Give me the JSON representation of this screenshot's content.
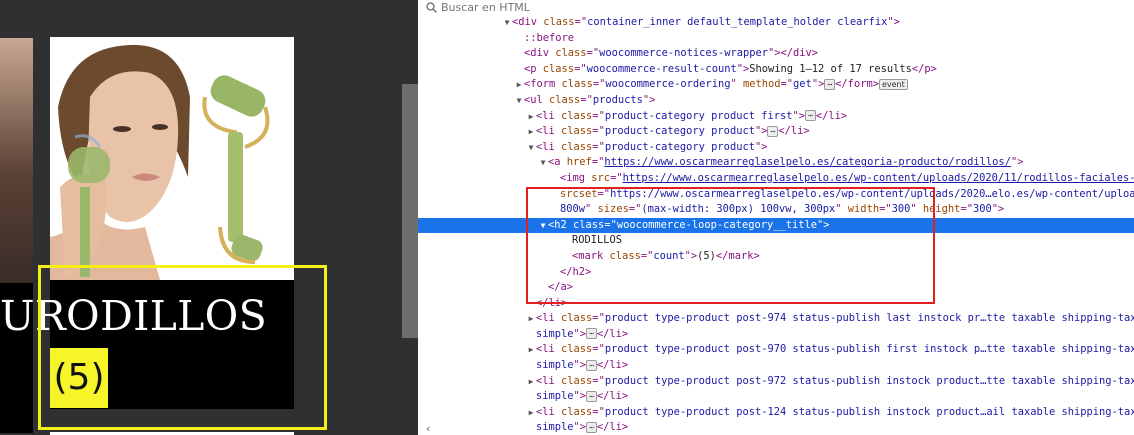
{
  "webpage": {
    "card_title": "RODILLOS",
    "card_title_prefix": "U",
    "card_count": "(5)"
  },
  "devtools": {
    "search": {
      "placeholder": "Buscar en HTML"
    },
    "tree": [
      {
        "indent": 0,
        "twisty": "▼",
        "html": [
          [
            "tag",
            "<div "
          ],
          [
            "attr",
            "class"
          ],
          [
            "tag",
            "=\""
          ],
          [
            "val",
            "container_inner default_template_holder clearfix"
          ],
          [
            "tag",
            "\">"
          ]
        ]
      },
      {
        "indent": 1,
        "twisty": "",
        "html": [
          [
            "pseudo",
            "::before"
          ]
        ]
      },
      {
        "indent": 1,
        "twisty": "",
        "html": [
          [
            "tag",
            "<div "
          ],
          [
            "attr",
            "class"
          ],
          [
            "tag",
            "=\""
          ],
          [
            "val",
            "woocommerce-notices-wrapper"
          ],
          [
            "tag",
            "\"></div>"
          ]
        ]
      },
      {
        "indent": 1,
        "twisty": "",
        "html": [
          [
            "tag",
            "<p "
          ],
          [
            "attr",
            "class"
          ],
          [
            "tag",
            "=\""
          ],
          [
            "val",
            "woocommerce-result-count"
          ],
          [
            "tag",
            "\">"
          ],
          [
            "txt",
            "Showing 1–12 of 17 results"
          ],
          [
            "tag",
            "</p>"
          ]
        ]
      },
      {
        "indent": 1,
        "twisty": "▶",
        "html": [
          [
            "tag",
            "<form "
          ],
          [
            "attr",
            "class"
          ],
          [
            "tag",
            "=\""
          ],
          [
            "val",
            "woocommerce-ordering"
          ],
          [
            "tag",
            "\" "
          ],
          [
            "attr",
            "method"
          ],
          [
            "tag",
            "=\""
          ],
          [
            "val",
            "get"
          ],
          [
            "tag",
            "\">"
          ],
          [
            "ell",
            "⋯"
          ],
          [
            "tag",
            "</form>"
          ],
          [
            "badge",
            "event"
          ]
        ]
      },
      {
        "indent": 1,
        "twisty": "▼",
        "html": [
          [
            "tag",
            "<ul "
          ],
          [
            "attr",
            "class"
          ],
          [
            "tag",
            "=\""
          ],
          [
            "val",
            "products"
          ],
          [
            "tag",
            "\">"
          ]
        ]
      },
      {
        "indent": 2,
        "twisty": "▶",
        "html": [
          [
            "tag",
            "<li "
          ],
          [
            "attr",
            "class"
          ],
          [
            "tag",
            "=\""
          ],
          [
            "val",
            "product-category product first"
          ],
          [
            "tag",
            "\">"
          ],
          [
            "ell",
            "⋯"
          ],
          [
            "tag",
            "</li>"
          ]
        ]
      },
      {
        "indent": 2,
        "twisty": "▶",
        "html": [
          [
            "tag",
            "<li "
          ],
          [
            "attr",
            "class"
          ],
          [
            "tag",
            "=\""
          ],
          [
            "val",
            "product-category product"
          ],
          [
            "tag",
            "\">"
          ],
          [
            "ell",
            "⋯"
          ],
          [
            "tag",
            "</li>"
          ]
        ]
      },
      {
        "indent": 2,
        "twisty": "▼",
        "html": [
          [
            "tag",
            "<li "
          ],
          [
            "attr",
            "class"
          ],
          [
            "tag",
            "=\""
          ],
          [
            "val",
            "product-category product"
          ],
          [
            "tag",
            "\">"
          ]
        ]
      },
      {
        "indent": 3,
        "twisty": "▼",
        "html": [
          [
            "tag",
            "<a "
          ],
          [
            "attr",
            "href"
          ],
          [
            "tag",
            "=\""
          ],
          [
            "lnk",
            "https://www.oscarmearreglaselpelo.es/categoria-producto/rodillos/"
          ],
          [
            "tag",
            "\">"
          ]
        ]
      },
      {
        "indent": 4,
        "twisty": "",
        "html": [
          [
            "tag",
            "<img "
          ],
          [
            "attr",
            "src"
          ],
          [
            "tag",
            "=\""
          ],
          [
            "lnk",
            "https://www.oscarmearreglaselpelo.es/wp-content/uploads/2020/11/rodillos-faciales-300x300.jpg"
          ]
        ]
      },
      {
        "indent": 4,
        "twisty": "",
        "html": [
          [
            "attr",
            "srcset"
          ],
          [
            "tag",
            "=\""
          ],
          [
            "val",
            "https://www.oscarmearreglaselpelo.es/wp-content/uploads/2020…elo.es/wp-content/uploads/2020/11/rodillos-faciales.jpg"
          ]
        ]
      },
      {
        "indent": 4,
        "twisty": "",
        "html": [
          [
            "val",
            "800w"
          ],
          [
            "tag",
            "\" "
          ],
          [
            "attr",
            "sizes"
          ],
          [
            "tag",
            "=\""
          ],
          [
            "val",
            "(max-width: 300px) 100vw, 300px"
          ],
          [
            "tag",
            "\" "
          ],
          [
            "attr",
            "width"
          ],
          [
            "tag",
            "=\""
          ],
          [
            "val",
            "300"
          ],
          [
            "tag",
            "\" "
          ],
          [
            "attr",
            "height"
          ],
          [
            "tag",
            "=\""
          ],
          [
            "val",
            "300"
          ],
          [
            "tag",
            "\">"
          ]
        ]
      },
      {
        "indent": 3,
        "twisty": "▼",
        "selected": true,
        "html": [
          [
            "tag",
            "<h2 "
          ],
          [
            "attr",
            "class"
          ],
          [
            "tag",
            "=\""
          ],
          [
            "val",
            "woocommerce-loop-category__title"
          ],
          [
            "tag",
            "\">"
          ]
        ]
      },
      {
        "indent": 5,
        "twisty": "",
        "html": [
          [
            "txt",
            "RODILLOS"
          ]
        ]
      },
      {
        "indent": 5,
        "twisty": "",
        "html": [
          [
            "tag",
            "<mark "
          ],
          [
            "attr",
            "class"
          ],
          [
            "tag",
            "=\""
          ],
          [
            "val",
            "count"
          ],
          [
            "tag",
            "\">"
          ],
          [
            "txt",
            "(5)"
          ],
          [
            "tag",
            "</mark>"
          ]
        ]
      },
      {
        "indent": 4,
        "twisty": "",
        "html": [
          [
            "tag",
            "</h2>"
          ]
        ]
      },
      {
        "indent": 3,
        "twisty": "",
        "html": [
          [
            "tag",
            "</a>"
          ]
        ]
      },
      {
        "indent": 2,
        "twisty": "",
        "html": [
          [
            "tag",
            "</li>"
          ]
        ]
      },
      {
        "indent": 2,
        "twisty": "▶",
        "html": [
          [
            "tag",
            "<li "
          ],
          [
            "attr",
            "class"
          ],
          [
            "tag",
            "=\""
          ],
          [
            "val",
            "product type-product post-974 status-publish last instock pr…tte taxable shipping-taxable purchasable product-type-"
          ]
        ]
      },
      {
        "indent": 2,
        "twisty": "",
        "html": [
          [
            "val",
            "simple"
          ],
          [
            "tag",
            "\">"
          ],
          [
            "ell",
            "⋯"
          ],
          [
            "tag",
            "</li>"
          ]
        ]
      },
      {
        "indent": 2,
        "twisty": "▶",
        "html": [
          [
            "tag",
            "<li "
          ],
          [
            "attr",
            "class"
          ],
          [
            "tag",
            "=\""
          ],
          [
            "val",
            "product type-product post-970 status-publish first instock p…tte taxable shipping-taxable purchasable product-type-"
          ]
        ]
      },
      {
        "indent": 2,
        "twisty": "",
        "html": [
          [
            "val",
            "simple"
          ],
          [
            "tag",
            "\">"
          ],
          [
            "ell",
            "⋯"
          ],
          [
            "tag",
            "</li>"
          ]
        ]
      },
      {
        "indent": 2,
        "twisty": "▶",
        "html": [
          [
            "tag",
            "<li "
          ],
          [
            "attr",
            "class"
          ],
          [
            "tag",
            "=\""
          ],
          [
            "val",
            "product type-product post-972 status-publish instock product…tte taxable shipping-taxable purchasable product-type-"
          ]
        ]
      },
      {
        "indent": 2,
        "twisty": "",
        "html": [
          [
            "val",
            "simple"
          ],
          [
            "tag",
            "\">"
          ],
          [
            "ell",
            "⋯"
          ],
          [
            "tag",
            "</li>"
          ]
        ]
      },
      {
        "indent": 2,
        "twisty": "▶",
        "html": [
          [
            "tag",
            "<li "
          ],
          [
            "attr",
            "class"
          ],
          [
            "tag",
            "=\""
          ],
          [
            "val",
            "product type-product post-124 status-publish instock product…ail taxable shipping-taxable purchasable product-type-"
          ]
        ]
      },
      {
        "indent": 2,
        "twisty": "",
        "html": [
          [
            "val",
            "simple"
          ],
          [
            "tag",
            "\">"
          ],
          [
            "ell",
            "⋯"
          ],
          [
            "tag",
            "</li>"
          ]
        ]
      }
    ]
  }
}
